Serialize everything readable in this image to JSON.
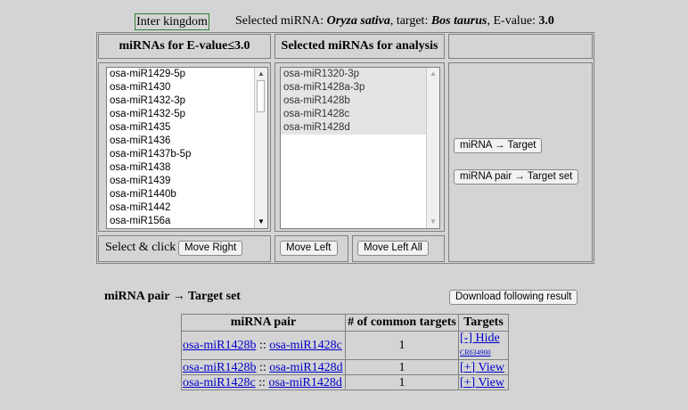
{
  "header": {
    "inter_kingdom_label": "Inter kingdom",
    "selected_prefix": "Selected miRNA: ",
    "mirna_species": "Oryza sativa",
    "target_prefix": ", target: ",
    "target_species": "Bos taurus",
    "evalue_prefix": ", E-value: ",
    "evalue": "3.0"
  },
  "panels": {
    "left_header": "miRNAs for E-value≤3.0",
    "middle_header": "Selected miRNAs for analysis",
    "left_list": [
      "osa-miR1429-5p",
      "osa-miR1430",
      "osa-miR1432-3p",
      "osa-miR1432-5p",
      "osa-miR1435",
      "osa-miR1436",
      "osa-miR1437b-5p",
      "osa-miR1438",
      "osa-miR1439",
      "osa-miR1440b",
      "osa-miR1442",
      "osa-miR156a"
    ],
    "middle_list": [
      "osa-miR1320-3p",
      "osa-miR1428a-3p",
      "osa-miR1428b",
      "osa-miR1428c",
      "osa-miR1428d"
    ],
    "select_click_label": "Select & click",
    "move_right_label": "Move Right",
    "move_left_label": "Move Left",
    "move_left_all_label": "Move Left All",
    "mirna_target_label": "miRNA → Target",
    "mirna_pair_label": "miRNA pair → Target set"
  },
  "result": {
    "title": "miRNA pair → Target set",
    "download_label": "Download following result",
    "columns": [
      "miRNA pair",
      "# of common targets",
      "Targets"
    ],
    "separator": " :: ",
    "rows": [
      {
        "a": "osa-miR1428b",
        "b": "osa-miR1428c",
        "count": "1",
        "action": "[-] Hide",
        "sub": "CR634900"
      },
      {
        "a": "osa-miR1428b",
        "b": "osa-miR1428d",
        "count": "1",
        "action": "[+] View",
        "sub": ""
      },
      {
        "a": "osa-miR1428c",
        "b": "osa-miR1428d",
        "count": "1",
        "action": "[+] View",
        "sub": ""
      }
    ]
  }
}
